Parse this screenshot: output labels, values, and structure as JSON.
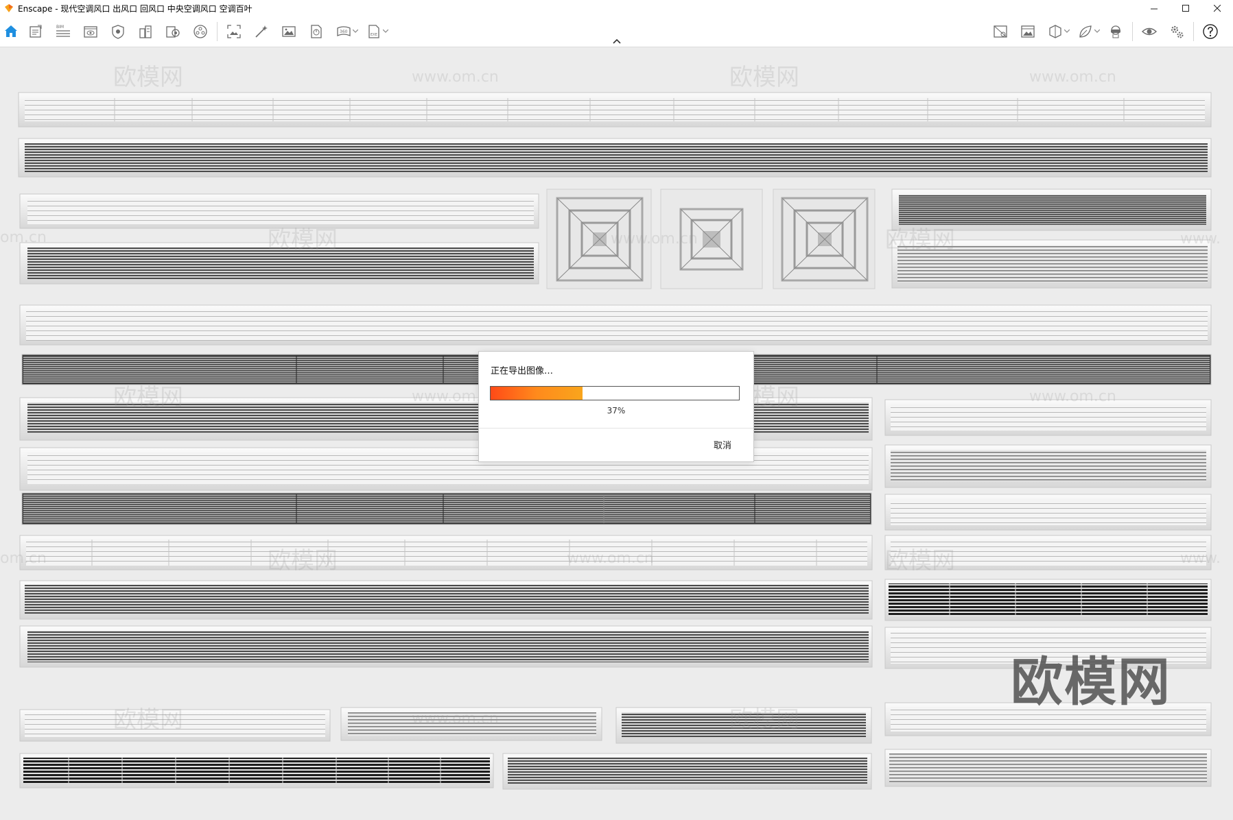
{
  "window": {
    "title": "Enscape - 现代空调风口 出风口 回风口 中央空调风口 空调百叶",
    "controls": [
      "minimize",
      "maximize",
      "close"
    ]
  },
  "toolbar": {
    "left_icons": [
      "home-icon",
      "project-info-icon",
      "bim-list-icon",
      "view-management-icon",
      "object-visibility-icon",
      "site-context-icon",
      "material-editor-icon",
      "atmosphere-icon",
      "capture-screenshot-icon",
      "batch-rendering-icon",
      "image-export-icon",
      "exe-export-icon",
      "panorama-icon",
      "web-standalone-icon"
    ],
    "right_icons": [
      "visual-settings-icon",
      "image-settings-icon",
      "section-icon",
      "asset-library-icon",
      "vr-headset-icon",
      "view-eye-icon",
      "general-settings-icon",
      "help-icon"
    ],
    "bim_label": "BIM"
  },
  "dialog": {
    "title": "正在导出图像…",
    "progress": 0.37,
    "progress_label": "37%",
    "cancel_label": "取消",
    "accent_start": "#ff4a17",
    "accent_end": "#f9a51c"
  },
  "watermarks": {
    "site_cn": "欧模网",
    "site_url": "www.om.cn",
    "url_fragment": "om.cn",
    "url_fragment_2": "www."
  }
}
